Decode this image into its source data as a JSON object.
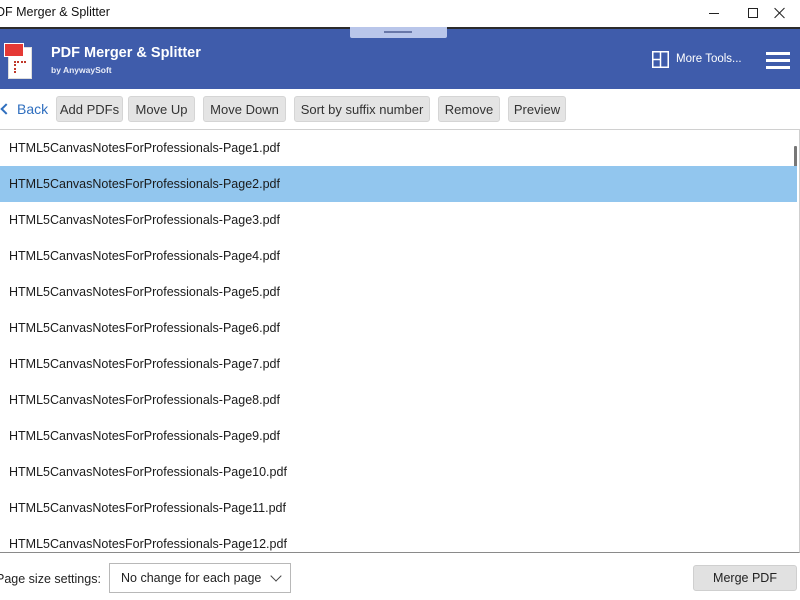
{
  "window": {
    "title": "DF Merger & Splitter"
  },
  "header": {
    "app_name": "PDF Merger & Splitter",
    "subtitle": "by AnywaySoft",
    "more_tools": "More Tools..."
  },
  "toolbar": {
    "back": "Back",
    "add": "Add PDFs",
    "move_up": "Move Up",
    "move_down": "Move Down",
    "sort": "Sort by suffix number",
    "remove": "Remove",
    "preview": "Preview"
  },
  "files": [
    {
      "name": "HTML5CanvasNotesForProfessionals-Page1.pdf",
      "selected": false
    },
    {
      "name": "HTML5CanvasNotesForProfessionals-Page2.pdf",
      "selected": true
    },
    {
      "name": "HTML5CanvasNotesForProfessionals-Page3.pdf",
      "selected": false
    },
    {
      "name": "HTML5CanvasNotesForProfessionals-Page4.pdf",
      "selected": false
    },
    {
      "name": "HTML5CanvasNotesForProfessionals-Page5.pdf",
      "selected": false
    },
    {
      "name": "HTML5CanvasNotesForProfessionals-Page6.pdf",
      "selected": false
    },
    {
      "name": "HTML5CanvasNotesForProfessionals-Page7.pdf",
      "selected": false
    },
    {
      "name": "HTML5CanvasNotesForProfessionals-Page8.pdf",
      "selected": false
    },
    {
      "name": "HTML5CanvasNotesForProfessionals-Page9.pdf",
      "selected": false
    },
    {
      "name": "HTML5CanvasNotesForProfessionals-Page10.pdf",
      "selected": false
    },
    {
      "name": "HTML5CanvasNotesForProfessionals-Page11.pdf",
      "selected": false
    },
    {
      "name": "HTML5CanvasNotesForProfessionals-Page12.pdf",
      "selected": false
    }
  ],
  "footer": {
    "page_size_label": "Page size settings:",
    "page_size_value": "No change for each page",
    "merge": "Merge PDF"
  },
  "colors": {
    "header_bg": "#3f5cab",
    "selected_row": "#92c6ee",
    "link_blue": "#2f6fbf"
  },
  "icons": {
    "logo": "pdf-merger-logo-icon",
    "more_tools": "grid-layout-icon",
    "menu": "hamburger-menu-icon",
    "back": "chevron-left-icon",
    "dropdown": "chevron-down-icon"
  }
}
